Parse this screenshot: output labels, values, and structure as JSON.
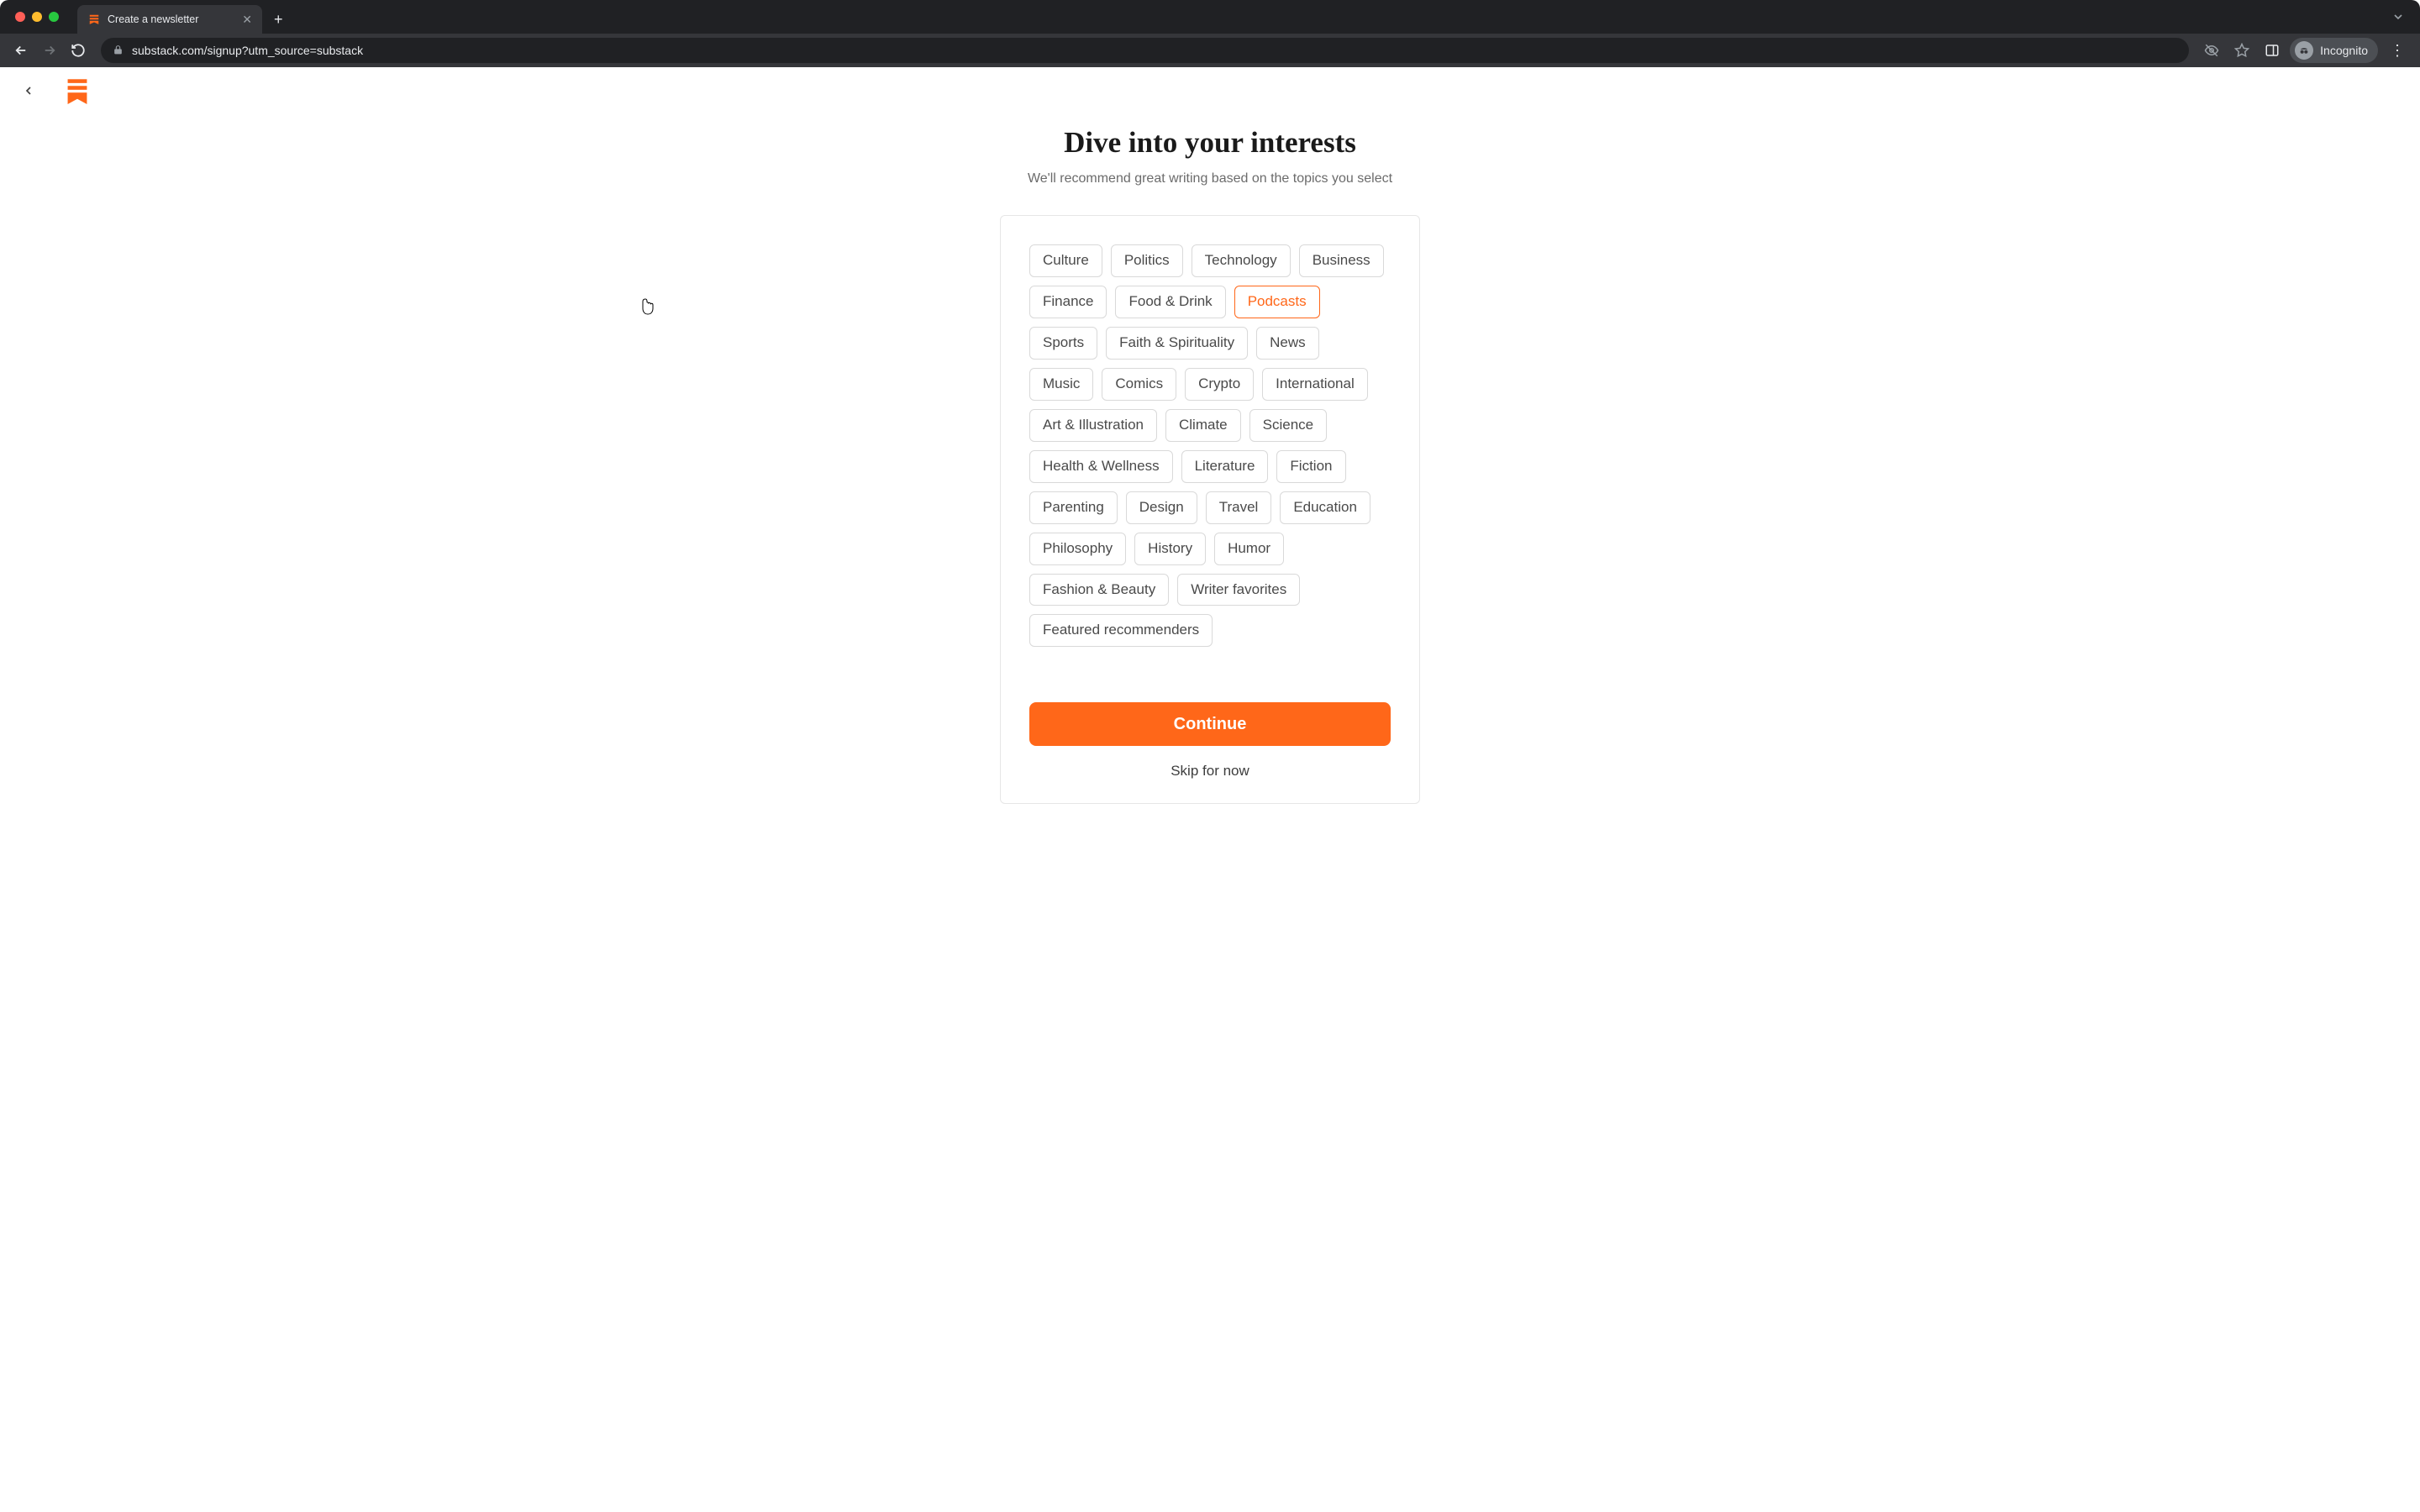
{
  "browser": {
    "tab_title": "Create a newsletter",
    "url": "substack.com/signup?utm_source=substack",
    "profile_label": "Incognito"
  },
  "page": {
    "heading": "Dive into your interests",
    "subheading": "We'll recommend great writing based on the topics you select",
    "continue_label": "Continue",
    "skip_label": "Skip for now",
    "topics": [
      {
        "label": "Culture",
        "selected": false
      },
      {
        "label": "Politics",
        "selected": false
      },
      {
        "label": "Technology",
        "selected": false
      },
      {
        "label": "Business",
        "selected": false
      },
      {
        "label": "Finance",
        "selected": false
      },
      {
        "label": "Food & Drink",
        "selected": false
      },
      {
        "label": "Podcasts",
        "selected": true
      },
      {
        "label": "Sports",
        "selected": false
      },
      {
        "label": "Faith & Spirituality",
        "selected": false
      },
      {
        "label": "News",
        "selected": false
      },
      {
        "label": "Music",
        "selected": false
      },
      {
        "label": "Comics",
        "selected": false
      },
      {
        "label": "Crypto",
        "selected": false
      },
      {
        "label": "International",
        "selected": false
      },
      {
        "label": "Art & Illustration",
        "selected": false
      },
      {
        "label": "Climate",
        "selected": false
      },
      {
        "label": "Science",
        "selected": false
      },
      {
        "label": "Health & Wellness",
        "selected": false
      },
      {
        "label": "Literature",
        "selected": false
      },
      {
        "label": "Fiction",
        "selected": false
      },
      {
        "label": "Parenting",
        "selected": false
      },
      {
        "label": "Design",
        "selected": false
      },
      {
        "label": "Travel",
        "selected": false
      },
      {
        "label": "Education",
        "selected": false
      },
      {
        "label": "Philosophy",
        "selected": false
      },
      {
        "label": "History",
        "selected": false
      },
      {
        "label": "Humor",
        "selected": false
      },
      {
        "label": "Fashion & Beauty",
        "selected": false
      },
      {
        "label": "Writer favorites",
        "selected": false
      },
      {
        "label": "Featured recommenders",
        "selected": false
      }
    ]
  },
  "colors": {
    "accent": "#ff6719"
  }
}
